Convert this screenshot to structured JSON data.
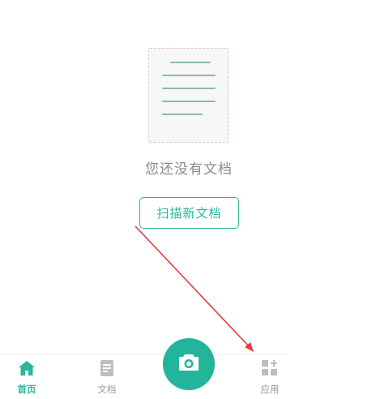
{
  "empty_state": {
    "message": "您还没有文档",
    "scan_button_label": "扫描新文档"
  },
  "bottom_nav": {
    "items": [
      {
        "label": "首页",
        "icon": "home-icon",
        "active": true
      },
      {
        "label": "文档",
        "icon": "document-icon",
        "active": false
      },
      {
        "label": "应用",
        "icon": "apps-grid-icon",
        "active": false
      }
    ],
    "center_button_icon": "camera-icon"
  },
  "colors": {
    "accent": "#2bb59c",
    "inactive": "#9a9a9a",
    "annotation": "#e53935"
  }
}
